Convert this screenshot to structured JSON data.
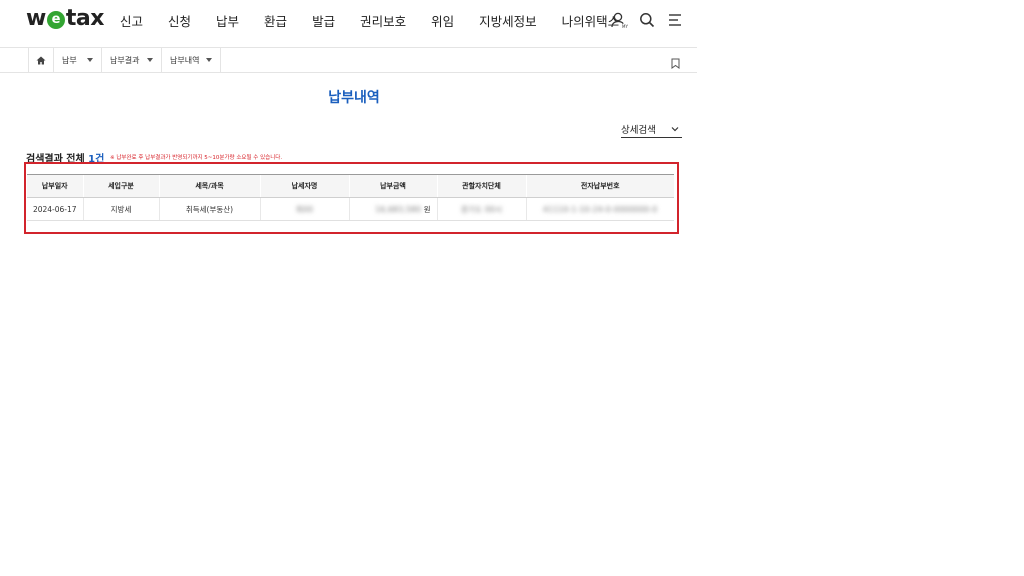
{
  "header": {
    "logo": {
      "pre": "w",
      "e": "e",
      "post": "tax"
    },
    "nav": [
      "신고",
      "신청",
      "납부",
      "환급",
      "발급",
      "권리보호",
      "위임",
      "지방세정보",
      "나의위택스"
    ],
    "icons": [
      "user-my-icon",
      "search-icon",
      "menu-icon"
    ]
  },
  "breadcrumb": {
    "items": [
      "납부",
      "납부결과",
      "납부내역"
    ]
  },
  "page": {
    "title": "납부내역",
    "detail_search": "상세검색"
  },
  "result": {
    "label": "검색결과 전체",
    "count": "1건",
    "notice": "※ 납부완료 후 납부결과가 반영되기까지 5~10분가량 소요될 수 있습니다."
  },
  "table": {
    "columns": [
      "납부일자",
      "세입구분",
      "세목/과목",
      "납세자명",
      "납부금액",
      "관할자치단체",
      "전자납부번호"
    ],
    "rows": [
      {
        "date": "2024-06-17",
        "type": "지방세",
        "item": "취득세(부동산)",
        "name": "최00",
        "amount": "16,683,580",
        "unit": "원",
        "org": "경기도 00시",
        "number": "41110-1-10-24-0-0000000-0"
      }
    ]
  },
  "colors": {
    "accent": "#1b5fbe",
    "logo_e": "#33a532",
    "highlight": "#d2242c",
    "notice": "#d8232a"
  }
}
